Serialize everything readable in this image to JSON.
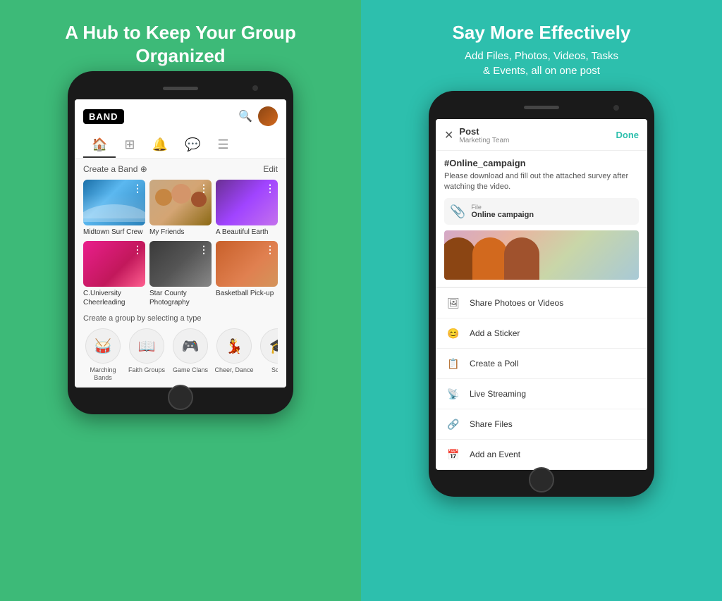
{
  "left_panel": {
    "title": "A Hub to Keep Your Group\nOrganized",
    "app_name": "BAND",
    "section_title": "Create a Band ⊕",
    "edit_label": "Edit",
    "groups": [
      {
        "name": "Midtown Surf Crew",
        "thumb": "surf"
      },
      {
        "name": "My Friends",
        "thumb": "friends"
      },
      {
        "name": "A Beautiful Earth",
        "thumb": "earth"
      },
      {
        "name": "C.University Cheerleading",
        "thumb": "cheer"
      },
      {
        "name": "Star County Photography",
        "thumb": "photography"
      },
      {
        "name": "Basketball Pick-up",
        "thumb": "basketball"
      }
    ],
    "create_group_text": "Create a group by selecting a type",
    "group_types": [
      {
        "label": "Marching Bands",
        "icon": "🥁"
      },
      {
        "label": "Faith Groups",
        "icon": "📖"
      },
      {
        "label": "Game Clans",
        "icon": "🎮"
      },
      {
        "label": "Cheer, Dance",
        "icon": "💃"
      },
      {
        "label": "Sc...",
        "icon": "🎓"
      }
    ]
  },
  "right_panel": {
    "title": "Say More Effectively",
    "subtitle": "Add Files, Photos, Videos, Tasks\n& Events, all on one post",
    "post": {
      "header": "Post",
      "subheader": "Marketing Team",
      "close_label": "✕",
      "done_label": "Done",
      "hashtag": "#Online_campaign",
      "body_text": "Please download and fill out the attached survey after watching the video.",
      "file_label": "File",
      "file_name": "Online campaign",
      "actions": [
        {
          "label": "Share Photoes or Videos",
          "icon": "photo"
        },
        {
          "label": "Add a Sticker",
          "icon": "sticker"
        },
        {
          "label": "Create a Poll",
          "icon": "poll"
        },
        {
          "label": "Live Streaming",
          "icon": "live"
        },
        {
          "label": "Share Files",
          "icon": "file"
        },
        {
          "label": "Add an Event",
          "icon": "event"
        }
      ]
    }
  },
  "colors": {
    "left_bg": "#3dba78",
    "right_bg": "#2dbfad",
    "done_color": "#2dbfad",
    "white": "#ffffff"
  }
}
